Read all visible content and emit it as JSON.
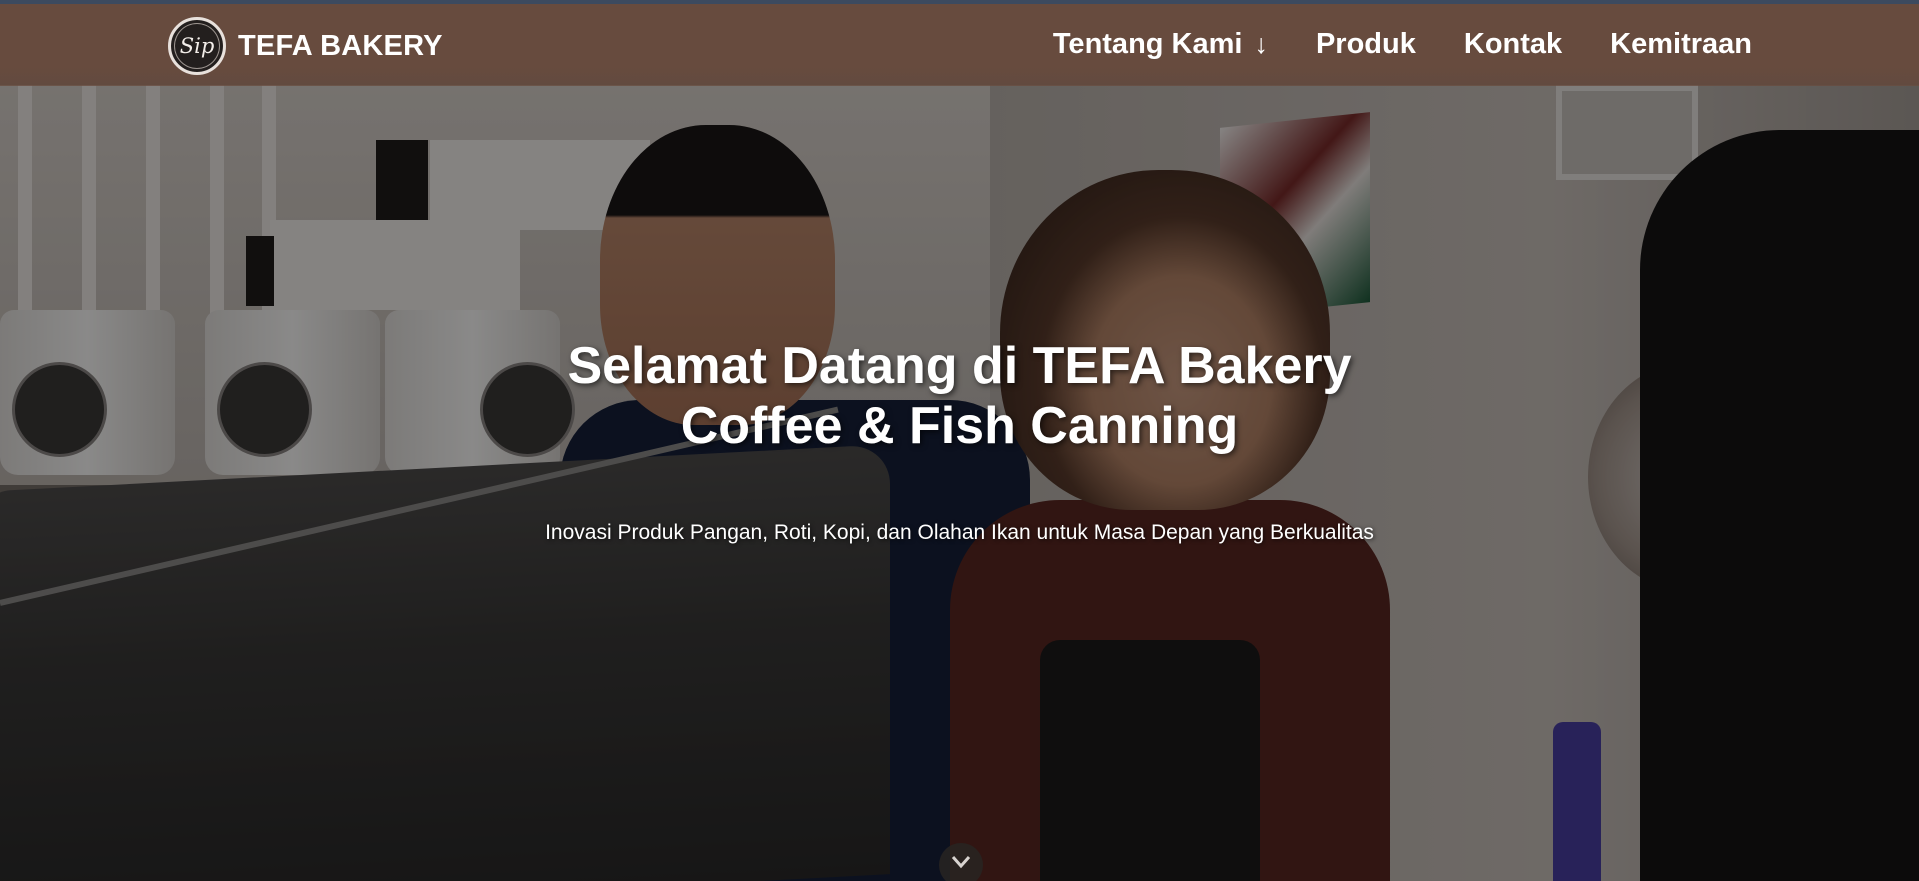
{
  "brand": {
    "logo_text": "Sip",
    "name": "TEFA BAKERY"
  },
  "nav": {
    "items": [
      {
        "label": "Tentang Kami",
        "arrow": "↓"
      },
      {
        "label": "Produk"
      },
      {
        "label": "Kontak"
      },
      {
        "label": "Kemitraan"
      }
    ]
  },
  "hero": {
    "title_line1": "Selamat Datang di TEFA Bakery",
    "title_line2": "Coffee & Fish Canning",
    "subtitle": "Inovasi Produk Pangan, Roti, Kopi, dan Olahan Ikan untuk Masa Depan yang Berkualitas",
    "scroll_icon": "chevron-down-icon"
  },
  "colors": {
    "navbar": "#684b3e",
    "top_line": "#3c4a5f",
    "text": "#ffffff"
  }
}
